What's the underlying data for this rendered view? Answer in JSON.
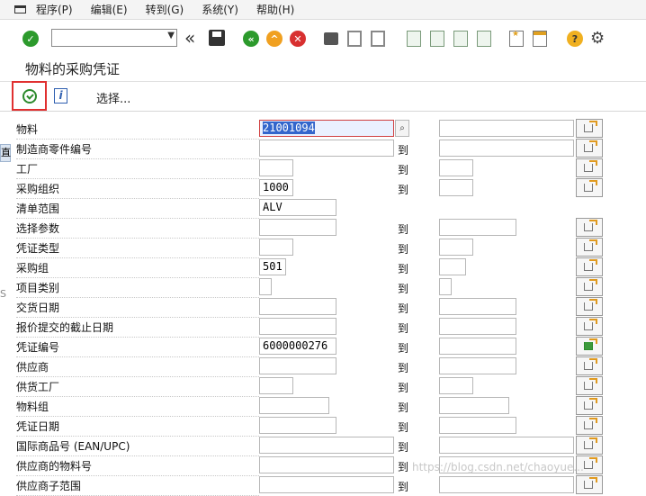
{
  "menu": [
    "程序(P)",
    "编辑(E)",
    "转到(G)",
    "系统(Y)",
    "帮助(H)"
  ],
  "title": "物料的采购凭证",
  "apptoolbar": {
    "select_label": "选择..."
  },
  "to_label": "到",
  "watermark": "https://blog.csdn.net/chaoyue...",
  "left_strip": [
    "直",
    "S"
  ],
  "rows": [
    {
      "label": "物料",
      "low": "21001094",
      "high": true
    },
    {
      "label": "制造商零件编号",
      "low": "",
      "high": true
    },
    {
      "label": "工厂",
      "low": "",
      "high": true
    },
    {
      "label": "采购组织",
      "low": "1000",
      "high": true
    },
    {
      "label": "清单范围",
      "low": "ALV",
      "high": false
    },
    {
      "label": "选择参数",
      "low": "",
      "high": true
    },
    {
      "label": "凭证类型",
      "low": "",
      "high": true
    },
    {
      "label": "采购组",
      "low": "501",
      "high": true
    },
    {
      "label": "项目类别",
      "low": "",
      "high": true
    },
    {
      "label": "交货日期",
      "low": "",
      "high": true
    },
    {
      "label": "报价提交的截止日期",
      "low": "",
      "high": true
    },
    {
      "label": "凭证编号",
      "low": "6000000276",
      "high": true
    },
    {
      "label": "供应商",
      "low": "",
      "high": true
    },
    {
      "label": "供货工厂",
      "low": "",
      "high": true
    },
    {
      "label": "物料组",
      "low": "",
      "high": true
    },
    {
      "label": "凭证日期",
      "low": "",
      "high": true
    },
    {
      "label": "国际商品号 (EAN/UPC)",
      "low": "",
      "high": true
    },
    {
      "label": "供应商的物料号",
      "low": "",
      "high": true
    },
    {
      "label": "供应商子范围",
      "low": "",
      "high": true
    }
  ]
}
